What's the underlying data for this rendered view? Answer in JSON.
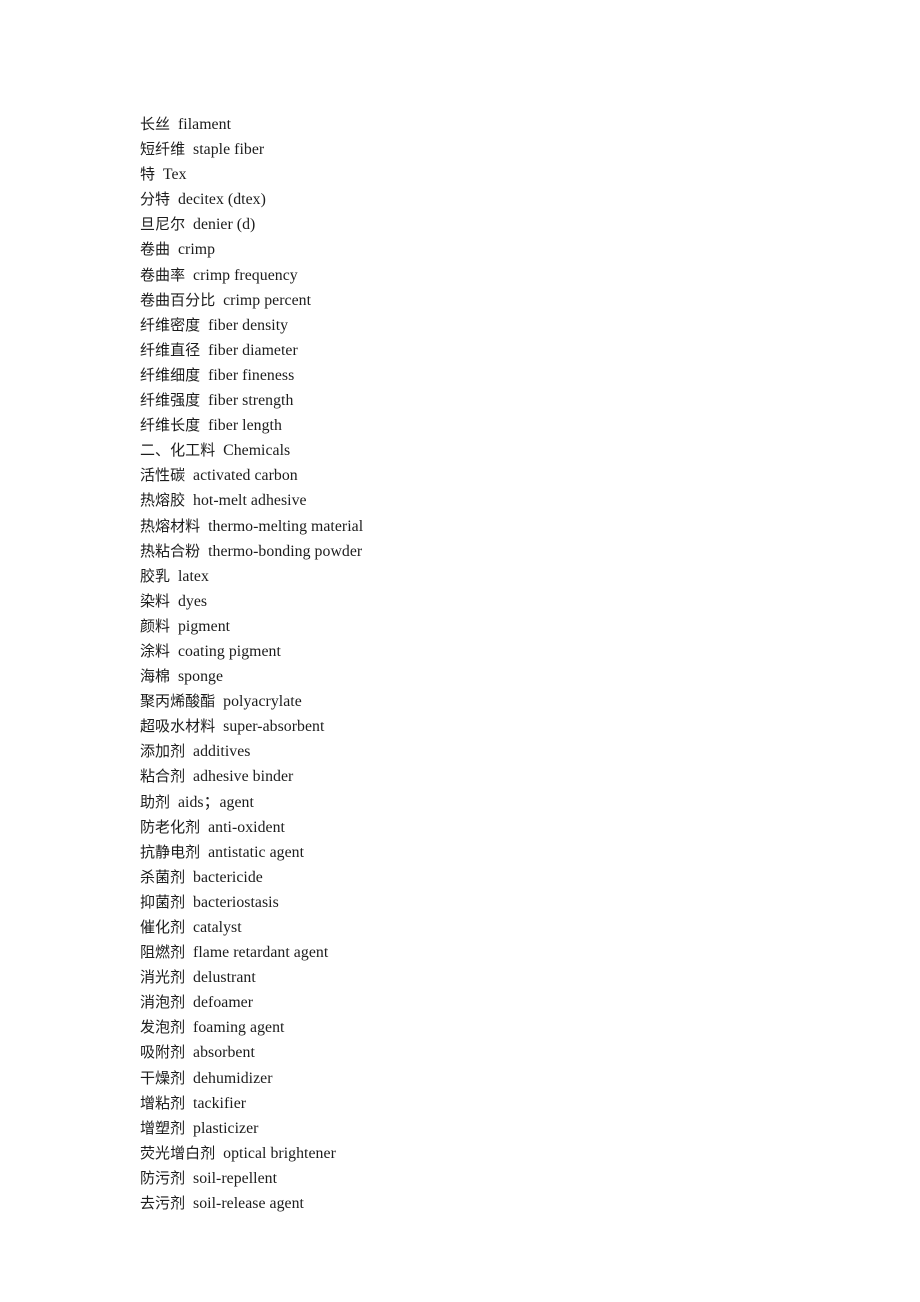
{
  "document": {
    "type": "bilingual-glossary",
    "language_pair": "zh-en",
    "text_color": "#1c1c1c",
    "background_color": "#ffffff"
  },
  "entries": [
    {
      "zh": "长丝",
      "en": "filament",
      "is_heading": false
    },
    {
      "zh": "短纤维",
      "en": "staple fiber",
      "is_heading": false
    },
    {
      "zh": "特",
      "en": "Tex",
      "is_heading": false
    },
    {
      "zh": "分特",
      "en": "decitex (dtex)",
      "is_heading": false
    },
    {
      "zh": "旦尼尔",
      "en": "denier (d)",
      "is_heading": false
    },
    {
      "zh": "卷曲",
      "en": "crimp",
      "is_heading": false
    },
    {
      "zh": "卷曲率",
      "en": "crimp frequency",
      "is_heading": false
    },
    {
      "zh": "卷曲百分比",
      "en": "crimp percent",
      "is_heading": false
    },
    {
      "zh": "纤维密度",
      "en": "fiber density",
      "is_heading": false
    },
    {
      "zh": "纤维直径",
      "en": "fiber diameter",
      "is_heading": false
    },
    {
      "zh": "纤维细度",
      "en": "fiber fineness",
      "is_heading": false
    },
    {
      "zh": "纤维强度",
      "en": "fiber strength",
      "is_heading": false
    },
    {
      "zh": "纤维长度",
      "en": "fiber length",
      "is_heading": false
    },
    {
      "zh": "二、化工料",
      "en": "Chemicals",
      "is_heading": true
    },
    {
      "zh": "活性碳",
      "en": "activated carbon",
      "is_heading": false
    },
    {
      "zh": "热熔胶",
      "en": "hot-melt adhesive",
      "is_heading": false
    },
    {
      "zh": "热熔材料",
      "en": "thermo-melting material",
      "is_heading": false
    },
    {
      "zh": "热粘合粉",
      "en": "thermo-bonding powder",
      "is_heading": false
    },
    {
      "zh": "胶乳",
      "en": "latex",
      "is_heading": false
    },
    {
      "zh": "染料",
      "en": "dyes",
      "is_heading": false
    },
    {
      "zh": "颜料",
      "en": "pigment",
      "is_heading": false
    },
    {
      "zh": "涂料",
      "en": "coating pigment",
      "is_heading": false
    },
    {
      "zh": "海棉",
      "en": "sponge",
      "is_heading": false
    },
    {
      "zh": "聚丙烯酸酯",
      "en": "polyacrylate",
      "is_heading": false
    },
    {
      "zh": "超吸水材料",
      "en": "super-absorbent",
      "is_heading": false
    },
    {
      "zh": "添加剂",
      "en": "additives",
      "is_heading": false
    },
    {
      "zh": "粘合剂",
      "en": "adhesive binder",
      "is_heading": false
    },
    {
      "zh": "助剂",
      "en": "aids；agent",
      "is_heading": false
    },
    {
      "zh": "防老化剂",
      "en": "anti-oxident",
      "is_heading": false
    },
    {
      "zh": "抗静电剂",
      "en": "antistatic agent",
      "is_heading": false
    },
    {
      "zh": "杀菌剂",
      "en": "bactericide",
      "is_heading": false
    },
    {
      "zh": "抑菌剂",
      "en": "bacteriostasis",
      "is_heading": false
    },
    {
      "zh": "催化剂",
      "en": "catalyst",
      "is_heading": false
    },
    {
      "zh": "阻燃剂",
      "en": "flame retardant agent",
      "is_heading": false
    },
    {
      "zh": "消光剂",
      "en": "delustrant",
      "is_heading": false
    },
    {
      "zh": "消泡剂",
      "en": "defoamer",
      "is_heading": false
    },
    {
      "zh": "发泡剂",
      "en": "foaming agent",
      "is_heading": false
    },
    {
      "zh": "吸附剂",
      "en": "absorbent",
      "is_heading": false
    },
    {
      "zh": "干燥剂",
      "en": "dehumidizer",
      "is_heading": false
    },
    {
      "zh": "增粘剂",
      "en": "tackifier",
      "is_heading": false
    },
    {
      "zh": "增塑剂",
      "en": "plasticizer",
      "is_heading": false
    },
    {
      "zh": "荧光增白剂",
      "en": "optical brightener",
      "is_heading": false
    },
    {
      "zh": "防污剂",
      "en": "soil-repellent",
      "is_heading": false
    },
    {
      "zh": "去污剂",
      "en": "soil-release agent",
      "is_heading": false
    }
  ]
}
